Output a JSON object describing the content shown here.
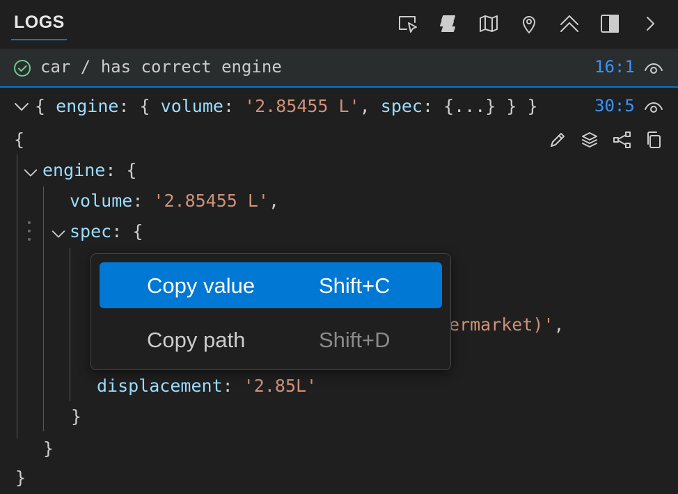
{
  "header": {
    "tab_label": "LOGS",
    "toolbar": [
      {
        "name": "select-element-icon"
      },
      {
        "name": "stack-icon"
      },
      {
        "name": "map-icon"
      },
      {
        "name": "location-pin-icon"
      },
      {
        "name": "collapse-all-icon"
      },
      {
        "name": "panel-layout-icon"
      },
      {
        "name": "chevron-right-icon"
      }
    ]
  },
  "test": {
    "status": "passed",
    "title": "car / has correct engine",
    "position": "16:1"
  },
  "log": {
    "summary": {
      "open": "{",
      "k1": "engine",
      "colon1": ": { ",
      "k2": "volume",
      "colon2": ": ",
      "v2": "'2.85455 L'",
      "sep": ", ",
      "k3": "spec",
      "colon3": ": ",
      "rest": "{...} } }"
    },
    "position": "30:5",
    "tree": {
      "open": "{",
      "engine_key": "engine",
      "engine_open": ": {",
      "volume_key": "volume",
      "volume_colon": ": ",
      "volume_value": "'2.85455 L'",
      "volume_comma": ",",
      "spec_key": "spec",
      "spec_open": ": {",
      "hidden_value_tail": "ermarket)'",
      "hidden_comma": ",",
      "displacement_key": "displacement",
      "displacement_colon": ": ",
      "displacement_value": "'2.85L'",
      "close_spec": "}",
      "close_engine": "}",
      "close_root": "}"
    }
  },
  "context_menu": {
    "items": [
      {
        "label": "Copy value",
        "shortcut": "Shift+C"
      },
      {
        "label": "Copy path",
        "shortcut": "Shift+D"
      }
    ]
  },
  "colors": {
    "accent": "#0078d4",
    "pass": "#73c991",
    "key": "#9cdcfe",
    "string": "#ce9178",
    "position": "#3794ff"
  }
}
